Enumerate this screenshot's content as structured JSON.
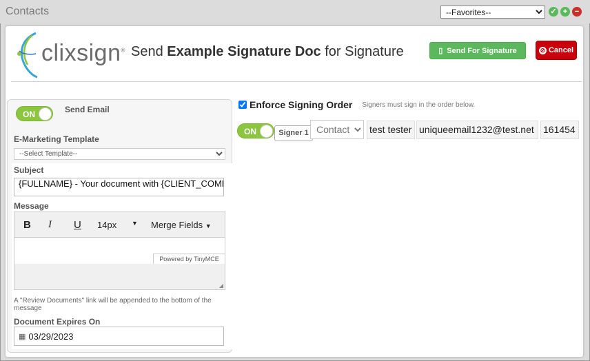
{
  "window": {
    "title": "Contacts"
  },
  "favorites": {
    "selected": "--Favorites--"
  },
  "header": {
    "logo_text": "clixsign",
    "logo_mark": "®",
    "heading_prefix": "Send ",
    "doc_name": "Example Signature Doc",
    "heading_suffix": " for Signature"
  },
  "buttons": {
    "send": "Send For Signature",
    "cancel": "Cancel"
  },
  "email": {
    "toggle": "ON",
    "send_email_label": "Send Email",
    "template_label": "E-Marketing Template",
    "template_selected": "--Select Template--",
    "subject_label": "Subject",
    "subject_value": "{FULLNAME} - Your document with {CLIENT_COMPANY} is ready to sign",
    "message_label": "Message",
    "font_size": "14px",
    "merge_fields": "Merge Fields",
    "powered_by": "Powered by TinyMCE",
    "note": "A \"Review Documents\" link will be appended to the bottom of the message",
    "expires_label": "Document Expires On",
    "expires_value": "03/29/2023"
  },
  "signing": {
    "enforce_label": "Enforce Signing Order",
    "enforce_checked": true,
    "enforce_hint": "Signers must sign in the order below.",
    "signers": [
      {
        "toggle": "ON",
        "label": "Signer 1",
        "type": "Contact",
        "name": "test tester",
        "email": "uniqueemail1232@test.net",
        "id": "161454"
      }
    ]
  },
  "colors": {
    "accent_green": "#5cb85c",
    "cancel_red": "#c9000c",
    "toggle_green": "#8cc63f"
  }
}
